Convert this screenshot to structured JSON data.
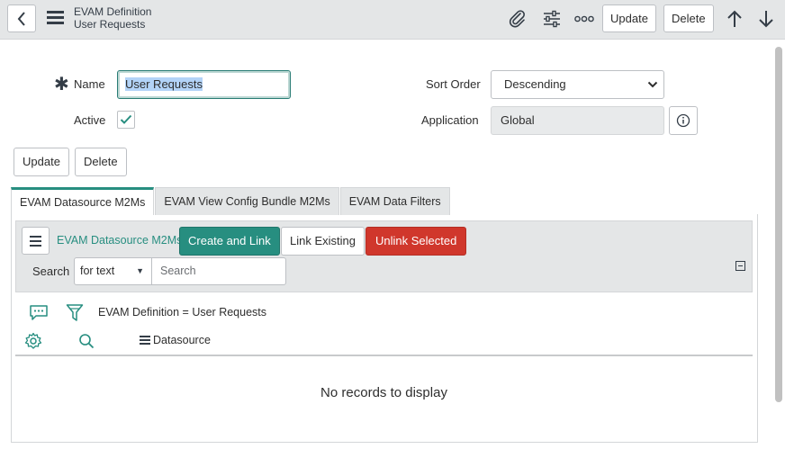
{
  "header": {
    "title_line1": "EVAM Definition",
    "title_line2": "User Requests",
    "update_label": "Update",
    "delete_label": "Delete"
  },
  "form": {
    "name_label": "Name",
    "name_value": "User Requests",
    "active_label": "Active",
    "active_checked": true,
    "sort_order_label": "Sort Order",
    "sort_order_value": "Descending",
    "application_label": "Application",
    "application_value": "Global",
    "update_label": "Update",
    "delete_label": "Delete"
  },
  "tabs": [
    {
      "label": "EVAM Datasource M2Ms",
      "active": true
    },
    {
      "label": "EVAM View Config Bundle M2Ms",
      "active": false
    },
    {
      "label": "EVAM Data Filters",
      "active": false
    }
  ],
  "related_list": {
    "title": "EVAM Datasource M2Ms",
    "create_label": "Create and Link",
    "link_label": "Link Existing",
    "unlink_label": "Unlink Selected",
    "search_label": "Search",
    "search_field_value": "for text",
    "search_placeholder": "Search",
    "filter_text": "EVAM Definition = User Requests",
    "column_header": "Datasource",
    "empty_message": "No records to display"
  },
  "colors": {
    "accent": "#278e80",
    "danger": "#d0372c",
    "header_bg": "#e4e6e7"
  }
}
